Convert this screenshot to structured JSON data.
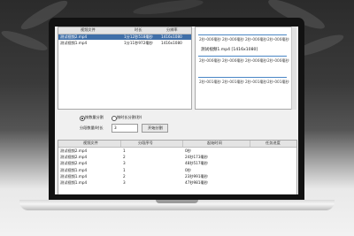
{
  "files": {
    "headers": [
      "视频文件",
      "时长",
      "分辨率"
    ],
    "rows": [
      {
        "name": "测试视频2.mp4",
        "duration": "1分12秒518毫秒",
        "resolution": "1416x1080",
        "selected": true
      },
      {
        "name": "测试视频1.mp4",
        "duration": "1分11秒972毫秒",
        "resolution": "1416x1080",
        "selected": false
      }
    ]
  },
  "timeline": {
    "top_ticks": [
      "2秒-000毫秒",
      "2秒-000毫秒",
      "2秒-000毫秒",
      "2秒-000毫秒"
    ],
    "track_title": "测试视频1.mp4 [1416x1080]",
    "mid_ticks": [
      "2秒-000毫秒",
      "2秒-000毫秒",
      "2秒-000毫秒",
      "2秒-000毫秒"
    ],
    "bottom_ticks": [
      "2秒-001毫秒",
      "2秒-001毫秒",
      "2秒-001毫秒",
      "2秒-001毫秒"
    ]
  },
  "options": {
    "radio1": "按数量分割",
    "radio2": "按时长分割(秒)",
    "label": "分段数量/时长",
    "value": "3",
    "button": "开始分割"
  },
  "results": {
    "headers": [
      "视频文件",
      "分段序号",
      "起始时间",
      "任务进度"
    ],
    "rows": [
      {
        "file": "测试视频2.mp4",
        "seg": "1",
        "start": "0秒"
      },
      {
        "file": "测试视频2.mp4",
        "seg": "2",
        "start": "24秒173毫秒"
      },
      {
        "file": "测试视频2.mp4",
        "seg": "3",
        "start": "48秒517毫秒"
      },
      {
        "file": "测试视频1.mp4",
        "seg": "1",
        "start": "0秒"
      },
      {
        "file": "测试视频1.mp4",
        "seg": "2",
        "start": "23秒991毫秒"
      },
      {
        "file": "测试视频1.mp4",
        "seg": "3",
        "start": "47秒981毫秒"
      }
    ]
  },
  "colors": {
    "selected_row": "#3f6fa8",
    "timeline_blue": "#4a86c5"
  }
}
